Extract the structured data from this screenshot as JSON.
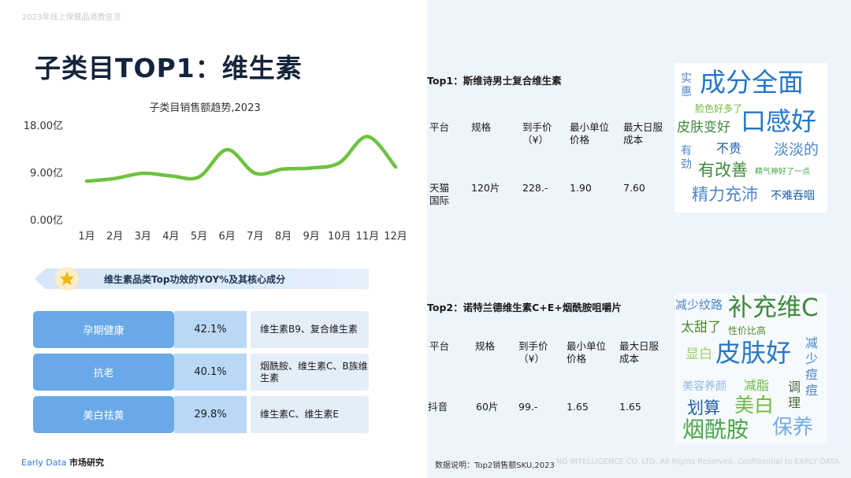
{
  "header_caption": "2023年线上保健品消费总览",
  "page_title": "子类目TOP1：维生素",
  "chart_data": {
    "type": "line",
    "title": "子类目销售额趋势,2023",
    "categories": [
      "1月",
      "2月",
      "3月",
      "4月",
      "5月",
      "6月",
      "7月",
      "8月",
      "9月",
      "10月",
      "11月",
      "12月"
    ],
    "values": [
      7.5,
      8.0,
      9.0,
      8.5,
      8.3,
      13.5,
      9.0,
      9.8,
      10.0,
      11.0,
      16.0,
      10.2
    ],
    "y_ticks": [
      "0.00亿",
      "9.00亿",
      "18.00亿"
    ],
    "ylim": [
      0,
      18
    ],
    "line_color": "#6ec23f"
  },
  "efficacy": {
    "banner_title": "维生素品类Top功效的YOY%及其核心成分",
    "star_icon": "star-icon",
    "rows": [
      {
        "name": "孕期健康",
        "pct": "42.1%",
        "ingredient": "维生素B9、复合维生素"
      },
      {
        "name": "抗老",
        "pct": "40.1%",
        "ingredient": "烟酰胺、维生素C、B族维生素"
      },
      {
        "name": "美白祛黄",
        "pct": "29.8%",
        "ingredient": "维生素C、维生素E"
      }
    ]
  },
  "footer": {
    "brand": "Early Data",
    "brand_suffix": "市场研究"
  },
  "top1": {
    "title": "Top1：斯维诗男士复合维生素",
    "headers": [
      "平台",
      "规格",
      "到手价（¥）",
      "最小单位价格",
      "最大日服成本"
    ],
    "row": [
      "天猫国际",
      "120片",
      "228.-",
      "1.90",
      "7.60"
    ]
  },
  "top2": {
    "title": "Top2：诺特兰德维生素C+E+烟酰胺咀嚼片",
    "headers": [
      "平台",
      "规格",
      "到手价（¥）",
      "最小单位价格",
      "最大日服成本"
    ],
    "row": [
      "抖音",
      "60片",
      "99.-",
      "1.65",
      "1.65"
    ]
  },
  "cloud1": {
    "words": [
      "实惠",
      "成分全面",
      "脸色好多了",
      "皮肤变好",
      "口感好",
      "有劲",
      "不贵",
      "淡淡的",
      "有改善",
      "精气神好了一点",
      "精力充沛",
      "不难吞咽"
    ]
  },
  "cloud2": {
    "words": [
      "减少纹路",
      "补充维C",
      "太甜了",
      "性价比高",
      "减少痘痘",
      "显白",
      "皮肤好",
      "美容养颜",
      "减脂",
      "调理",
      "划算",
      "美白",
      "烟酰胺",
      "保养"
    ]
  },
  "note": "数据说明：Top2销售额SKU,2023",
  "watermark": "NG INTELLIGENCE CO. LTD. All Rights Reserved. Confidential to EARLY DATA"
}
